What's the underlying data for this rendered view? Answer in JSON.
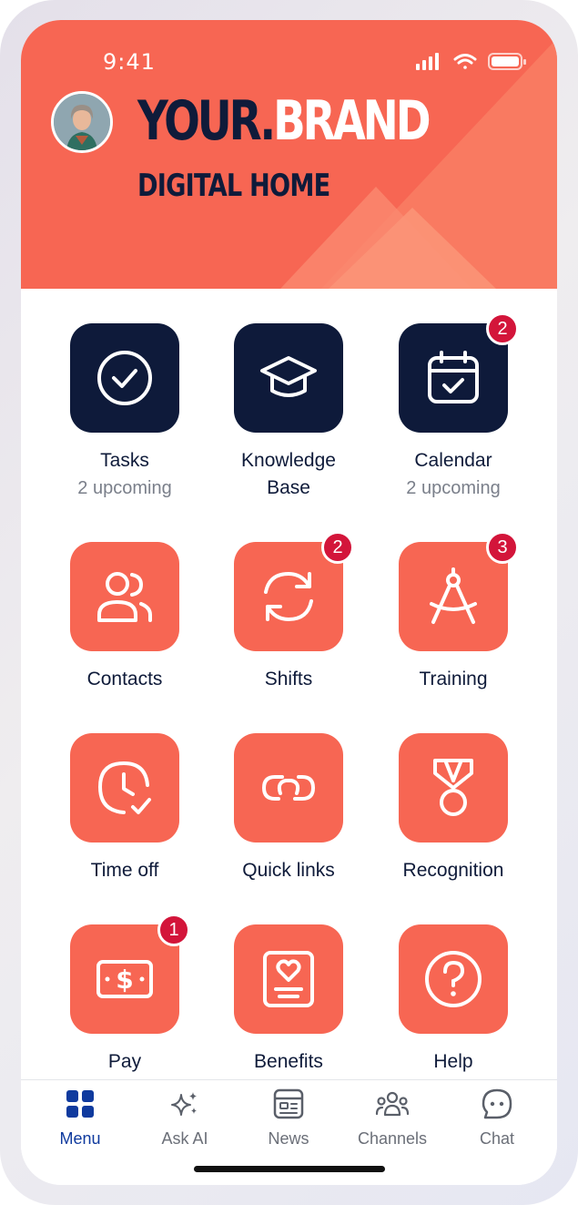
{
  "status_bar": {
    "time": "9:41"
  },
  "header": {
    "brand_part1": "YOUR.",
    "brand_part2": "BRAND",
    "subtitle": "DIGITAL HOME",
    "accent_color": "#f76653",
    "navy_color": "#0e1a3a"
  },
  "tiles": [
    {
      "label": "Tasks",
      "sub": "2 upcoming",
      "icon": "check-circle-icon"
    },
    {
      "label": "Knowledge",
      "label2": "Base",
      "icon": "graduation-cap-icon"
    },
    {
      "label": "Calendar",
      "sub": "2 upcoming",
      "badge": "2",
      "icon": "calendar-check-icon"
    },
    {
      "label": "Contacts",
      "icon": "users-icon"
    },
    {
      "label": "Shifts",
      "badge": "2",
      "icon": "refresh-icon"
    },
    {
      "label": "Training",
      "badge": "3",
      "icon": "compass-icon"
    },
    {
      "label": "Time off",
      "icon": "clock-check-icon"
    },
    {
      "label": "Quick links",
      "icon": "link-icon"
    },
    {
      "label": "Recognition",
      "icon": "medal-icon"
    },
    {
      "label": "Pay",
      "badge": "1",
      "icon": "banknote-icon"
    },
    {
      "label": "Benefits",
      "icon": "heart-document-icon"
    },
    {
      "label": "Help",
      "icon": "question-circle-icon"
    }
  ],
  "nav": [
    {
      "label": "Menu",
      "active": true,
      "icon": "grid-icon"
    },
    {
      "label": "Ask AI",
      "icon": "sparkles-icon"
    },
    {
      "label": "News",
      "icon": "newspaper-icon"
    },
    {
      "label": "Channels",
      "icon": "group-icon"
    },
    {
      "label": "Chat",
      "icon": "chat-bubble-icon"
    }
  ]
}
